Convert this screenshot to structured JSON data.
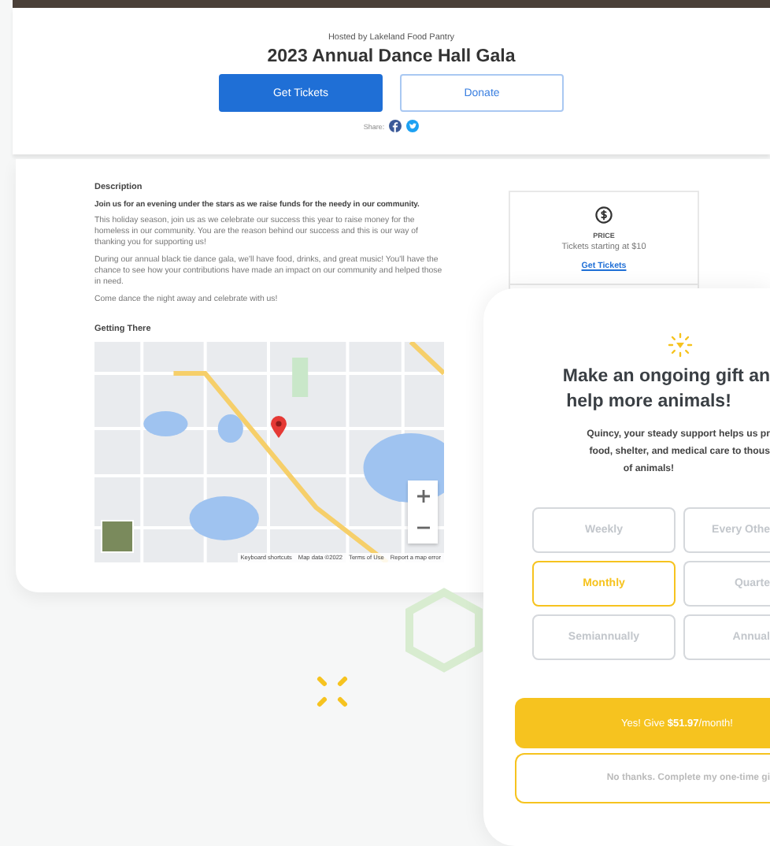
{
  "event": {
    "host": "Hosted by Lakeland Food Pantry",
    "title": "2023 Annual Dance Hall Gala",
    "buttons": [
      {
        "label": "Get Tickets",
        "kind": "primary"
      },
      {
        "label": "Donate",
        "kind": "secondary"
      }
    ],
    "share_label": "Share:"
  },
  "description": {
    "heading": "Description",
    "lead": "Join us for an evening under the stars as we raise funds for the needy in our community.",
    "paragraphs": [
      "This holiday season, join us as we celebrate our success this year to raise money for the homeless in our community. You are the reason behind our success and this is our way of thanking you for supporting us!",
      "During our annual black tie dance gala, we'll have food, drinks, and great music! You'll have the chance to see how your contributions have made an impact on our community and helped those in need.",
      "Come dance the night away and celebrate with us!"
    ]
  },
  "getting_there": {
    "heading": "Getting There",
    "map_footer": [
      "Keyboard shortcuts",
      "Map data ©2022",
      "Terms of Use",
      "Report a map error"
    ]
  },
  "price": {
    "label": "PRICE",
    "text": "Tickets starting at $10",
    "link": "Get Tickets"
  },
  "recurring_modal": {
    "heading_lines": [
      "Make an ongoing gift an",
      "help more animals!"
    ],
    "message_lines": [
      "Quincy, your steady support helps us pr",
      "food, shelter, and medical care to thous",
      "of animals!"
    ],
    "frequencies": [
      {
        "label": "Weekly",
        "selected": false
      },
      {
        "label": "Every Othe",
        "selected": false
      },
      {
        "label": "Monthly",
        "selected": true
      },
      {
        "label": "Quarte",
        "selected": false
      },
      {
        "label": "Semiannually",
        "selected": false
      },
      {
        "label": "Annual",
        "selected": false
      }
    ],
    "confirm": "Yes! Give **$51.97**/month!",
    "decline": "No thanks. Complete my one-time gi"
  }
}
